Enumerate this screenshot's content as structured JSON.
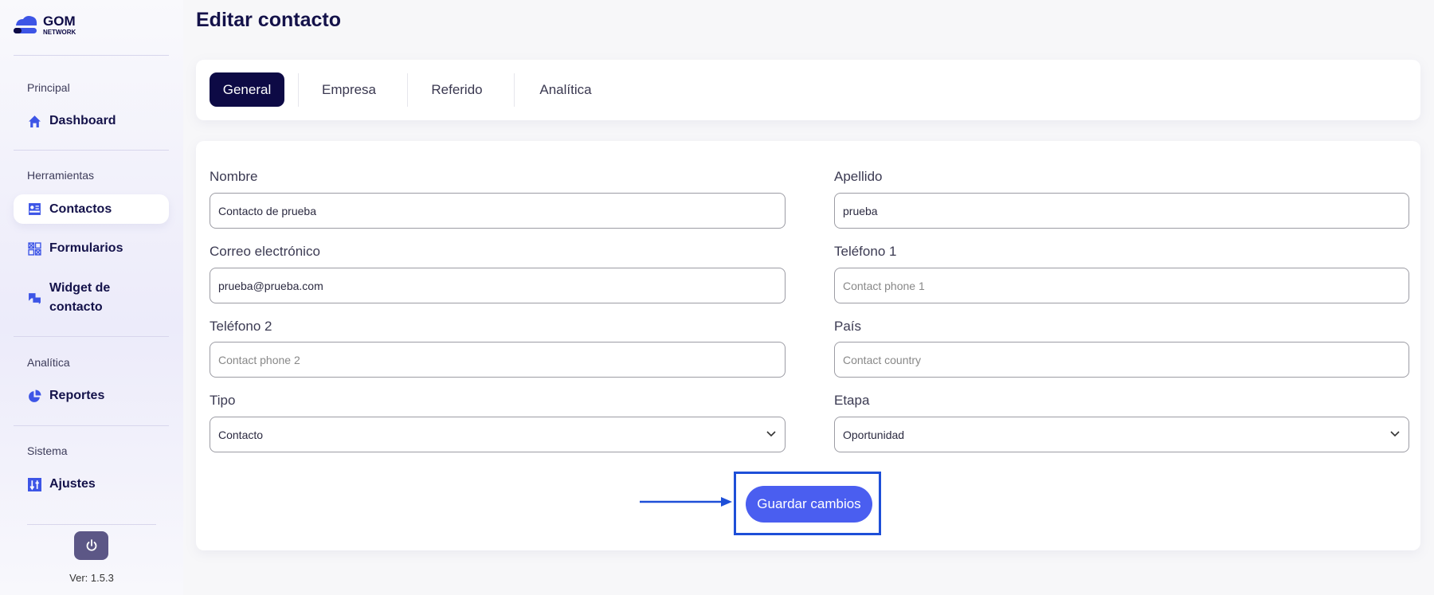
{
  "sidebar": {
    "logo": {
      "title": "GOM",
      "subtitle": "NETWORK"
    },
    "sections": [
      {
        "label": "Principal",
        "items": [
          {
            "label": "Dashboard",
            "icon": "home-icon"
          }
        ]
      },
      {
        "label": "Herramientas",
        "items": [
          {
            "label": "Contactos",
            "icon": "contact-card-icon",
            "active": true
          },
          {
            "label": "Formularios",
            "icon": "forms-grid-icon"
          },
          {
            "label": "Widget de contacto",
            "icon": "chat-bubbles-icon"
          }
        ]
      },
      {
        "label": "Analítica",
        "items": [
          {
            "label": "Reportes",
            "icon": "pie-chart-icon"
          }
        ]
      },
      {
        "label": "Sistema",
        "items": [
          {
            "label": "Ajustes",
            "icon": "sliders-icon"
          }
        ]
      }
    ],
    "version": "Ver: 1.5.3"
  },
  "page": {
    "title": "Editar contacto"
  },
  "tabs": [
    {
      "label": "General",
      "active": true
    },
    {
      "label": "Empresa"
    },
    {
      "label": "Referido"
    },
    {
      "label": "Analítica"
    }
  ],
  "form": {
    "nombre": {
      "label": "Nombre",
      "value": "Contacto de prueba"
    },
    "apellido": {
      "label": "Apellido",
      "value": "prueba"
    },
    "correo": {
      "label": "Correo electrónico",
      "value": "prueba@prueba.com"
    },
    "telefono1": {
      "label": "Teléfono 1",
      "placeholder": "Contact phone 1"
    },
    "telefono2": {
      "label": "Teléfono 2",
      "placeholder": "Contact phone 2"
    },
    "pais": {
      "label": "País",
      "placeholder": "Contact country"
    },
    "tipo": {
      "label": "Tipo",
      "value": "Contacto"
    },
    "etapa": {
      "label": "Etapa",
      "value": "Oportunidad"
    },
    "save_label": "Guardar cambios"
  },
  "colors": {
    "accent": "#4a5ef0",
    "navy": "#0d0a45",
    "highlight": "#1e4fd8"
  }
}
